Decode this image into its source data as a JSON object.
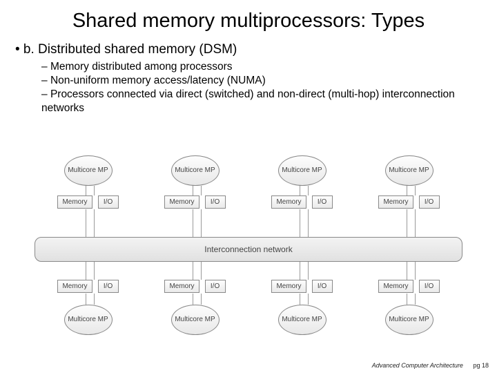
{
  "title": "Shared memory multiprocessors: Types",
  "main_bullet": "• b. Distributed shared memory (DSM)",
  "sub_bullets": [
    "Memory distributed among processors",
    "Non-uniform memory access/latency (NUMA)",
    "Processors connected via direct (switched) and non-direct (multi-hop) interconnection networks"
  ],
  "diagram": {
    "mp_label": "Multicore MP",
    "memory_label": "Memory",
    "io_label": "I/O",
    "interconnect_label": "Interconnection network",
    "node_count": 4
  },
  "footer": {
    "course": "Advanced Computer Architecture",
    "page_prefix": "pg",
    "page_number": "18"
  }
}
